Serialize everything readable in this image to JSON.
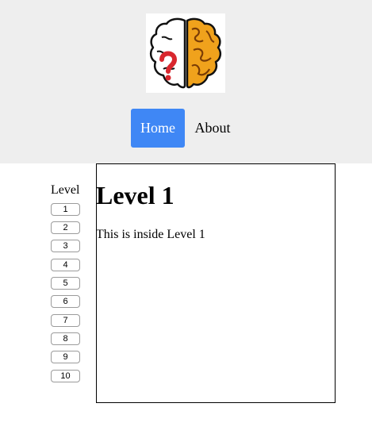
{
  "header": {
    "logo": "brain-question-logo",
    "nav": {
      "home_label": "Home",
      "about_label": "About"
    },
    "colors": {
      "background": "#eeeeee",
      "home_active": "#3f87f5"
    }
  },
  "sidebar": {
    "heading": "Level",
    "levels": [
      "1",
      "2",
      "3",
      "4",
      "5",
      "6",
      "7",
      "8",
      "9",
      "10"
    ]
  },
  "main": {
    "title": "Level 1",
    "text": "This is inside Level 1"
  }
}
